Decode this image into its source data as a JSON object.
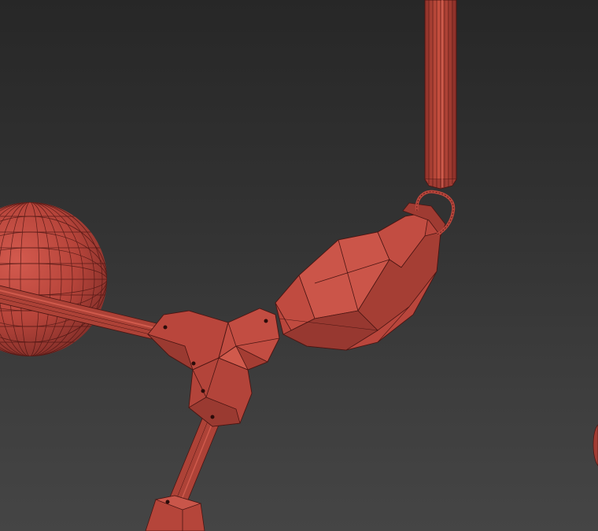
{
  "scene": {
    "kind": "3d-viewport-wireframe-render",
    "background_top": "#272727",
    "background_bottom": "#454545",
    "mesh_fill": "#b9463c",
    "mesh_fill_dark": "#8a2f28",
    "mesh_fill_light": "#d45b4f",
    "wire_color": "#4a1512",
    "objects": [
      "vertical-rod",
      "hook-ring",
      "hanging-weight",
      "connector-hub",
      "left-rod",
      "sphere",
      "lower-rod",
      "lower-block",
      "partial-sphere-right"
    ]
  }
}
